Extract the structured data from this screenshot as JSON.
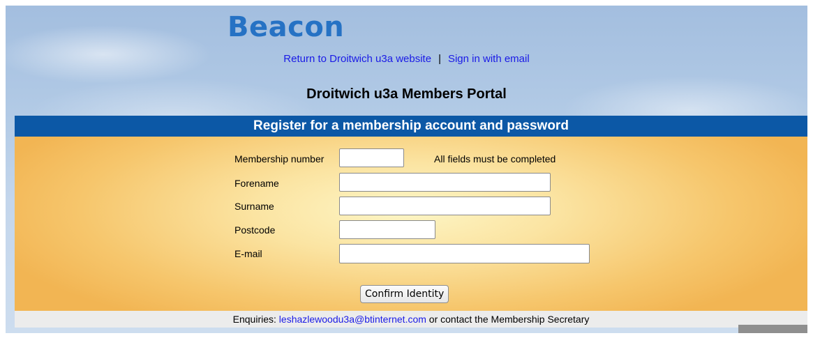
{
  "brand": {
    "logo_text": "Beacon"
  },
  "top_links": {
    "return_link": "Return to Droitwich u3a website",
    "separator": "|",
    "sign_in_link": "Sign in with email"
  },
  "portal_title": "Droitwich u3a Members Portal",
  "form": {
    "header": "Register for a membership account and password",
    "note": "All fields must be completed",
    "fields": {
      "membership_number": {
        "label": "Membership number",
        "value": ""
      },
      "forename": {
        "label": "Forename",
        "value": ""
      },
      "surname": {
        "label": "Surname",
        "value": ""
      },
      "postcode": {
        "label": "Postcode",
        "value": ""
      },
      "email": {
        "label": "E-mail",
        "value": ""
      }
    },
    "submit_label": "Confirm Identity"
  },
  "footer": {
    "prefix": "Enquiries: ",
    "email_link": "leshazlewoodu3a@btinternet.com",
    "suffix": " or contact the Membership Secretary"
  },
  "colors": {
    "header_bar": "#0c58a6",
    "logo": "#2672c4",
    "link": "#1a1ae6",
    "form_background": "#f6c66c"
  }
}
